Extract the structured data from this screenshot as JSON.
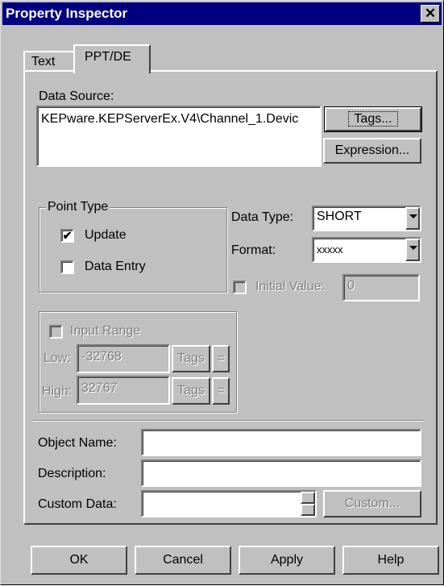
{
  "window": {
    "title": "Property Inspector",
    "close_glyph": "✕"
  },
  "tabs": [
    {
      "label": "Text"
    },
    {
      "label": "PPT/DE"
    }
  ],
  "data_source": {
    "label": "Data Source:",
    "value": "KEPware.KEPServerEx.V4\\Channel_1.Devic",
    "tags_button": "Tags...",
    "expression_button": "Expression..."
  },
  "point_type": {
    "title": "Point Type",
    "update": {
      "label": "Update",
      "checked": true
    },
    "data_entry": {
      "label": "Data Entry",
      "checked": false
    }
  },
  "data_type": {
    "label": "Data Type:",
    "value": "SHORT"
  },
  "format": {
    "label": "Format:",
    "value": "xxxxx"
  },
  "initial_value": {
    "label": "Initial Value:",
    "value": "0"
  },
  "input_range": {
    "label": "Input Range",
    "low_label": "Low:",
    "low_value": "-32768",
    "high_label": "High:",
    "high_value": "32767",
    "tags_label": "Tags",
    "eq_label": "="
  },
  "object_name": {
    "label": "Object Name:",
    "value": ""
  },
  "description": {
    "label": "Description:",
    "value": ""
  },
  "custom_data": {
    "label": "Custom Data:",
    "value": "",
    "button": "Custom..."
  },
  "buttons": {
    "ok": "OK",
    "cancel": "Cancel",
    "apply": "Apply",
    "help": "Help"
  },
  "check_glyph": "✔"
}
